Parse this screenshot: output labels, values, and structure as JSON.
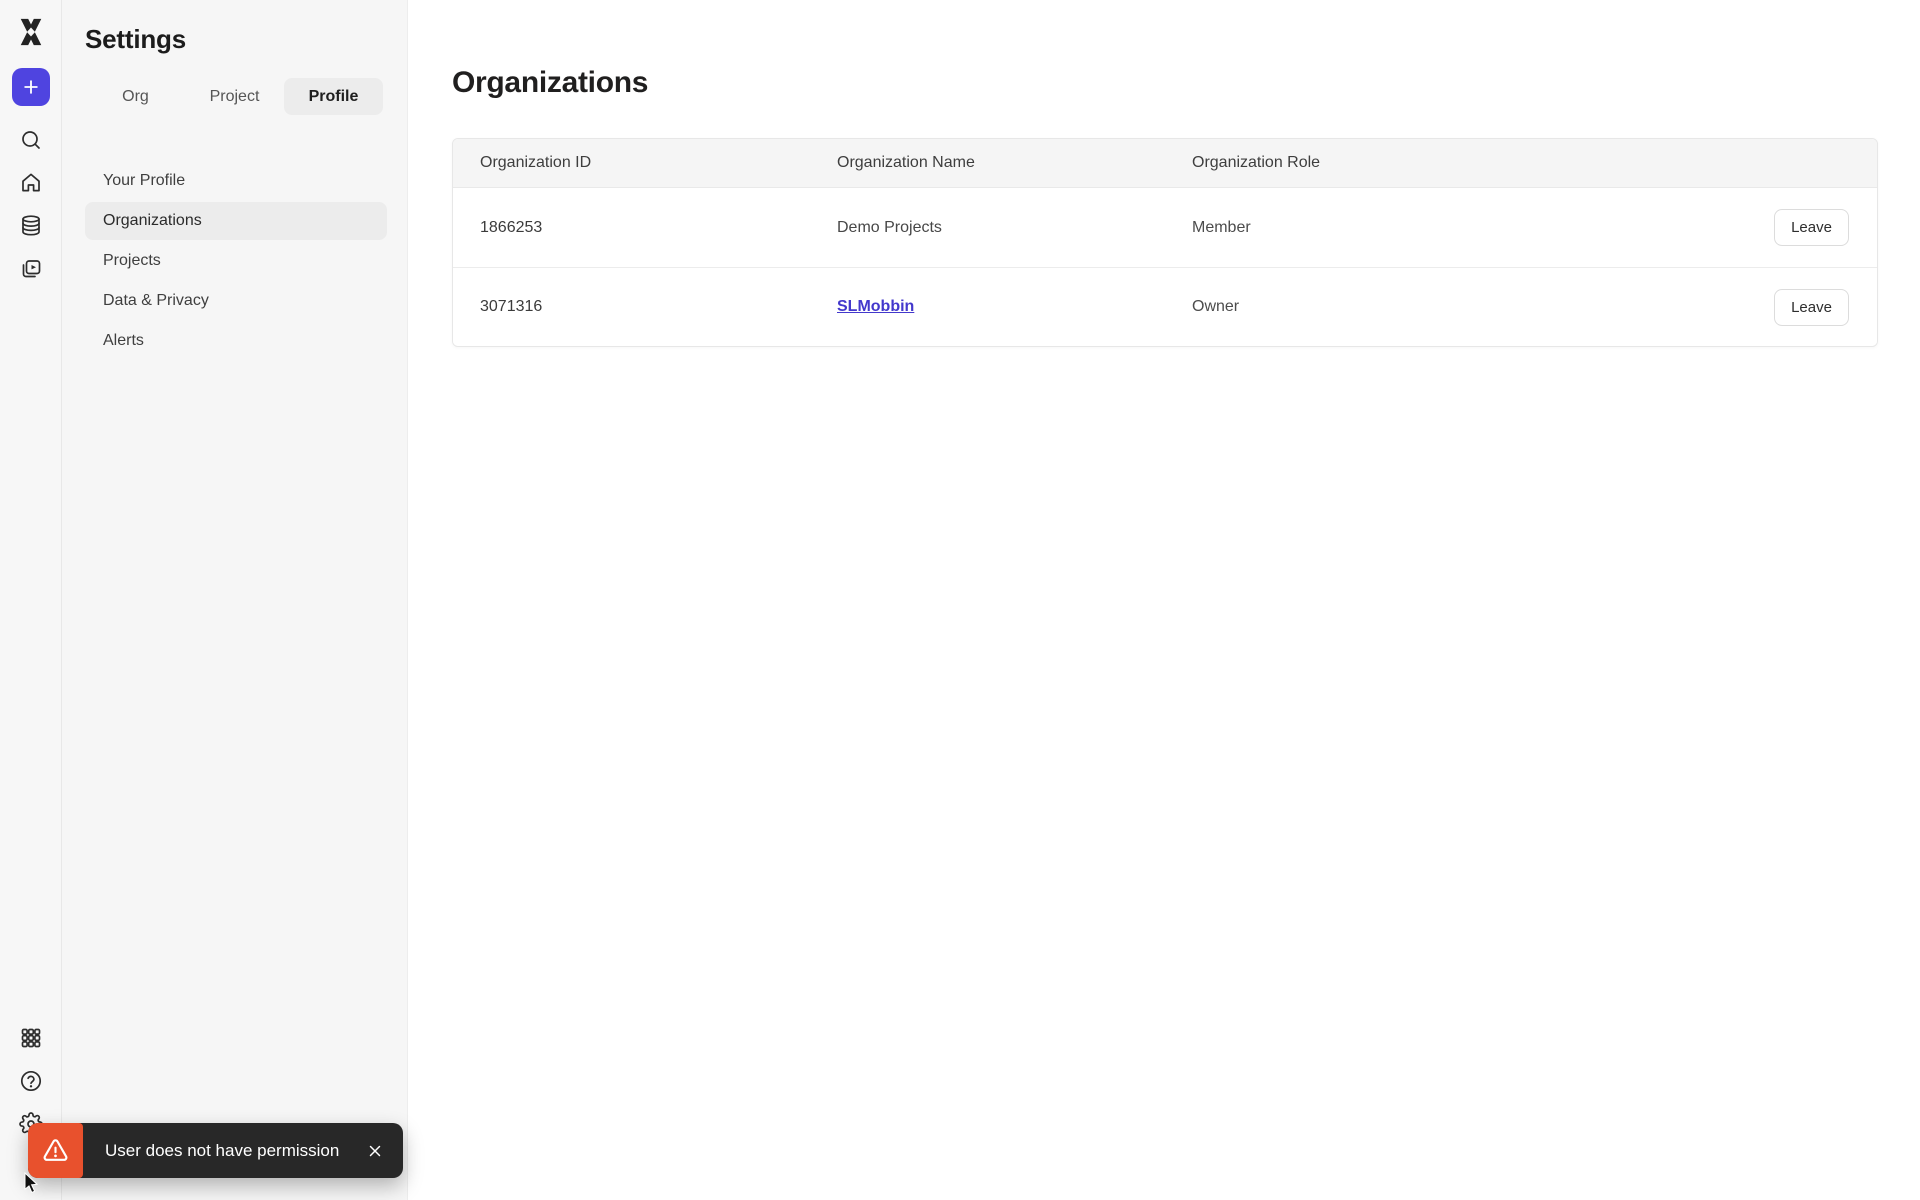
{
  "rail": {
    "icons": [
      "mixpanel-logo",
      "plus",
      "search",
      "home",
      "database",
      "video-boards",
      "apps-grid",
      "help",
      "settings-gear"
    ]
  },
  "sidebar": {
    "title": "Settings",
    "tabs": [
      {
        "label": "Org",
        "active": false
      },
      {
        "label": "Project",
        "active": false
      },
      {
        "label": "Profile",
        "active": true
      }
    ],
    "items": [
      {
        "label": "Your Profile",
        "active": false
      },
      {
        "label": "Organizations",
        "active": true
      },
      {
        "label": "Projects",
        "active": false
      },
      {
        "label": "Data & Privacy",
        "active": false
      },
      {
        "label": "Alerts",
        "active": false
      }
    ]
  },
  "main": {
    "title": "Organizations",
    "table": {
      "columns": [
        "Organization ID",
        "Organization Name",
        "Organization Role"
      ],
      "rows": [
        {
          "id": "1866253",
          "name": "Demo Projects",
          "name_is_link": false,
          "role": "Member",
          "action": "Leave"
        },
        {
          "id": "3071316",
          "name": "SLMobbin",
          "name_is_link": true,
          "role": "Owner",
          "action": "Leave"
        }
      ]
    }
  },
  "toast": {
    "message": "User does not have permission",
    "icon": "warning-triangle-icon"
  },
  "colors": {
    "accent_purple": "#4f44e0",
    "link_indigo": "#4338cc",
    "toast_background": "#282828",
    "warning_orange": "#e8512d",
    "sidebar_background": "#f6f6f6",
    "table_header_background": "#f5f5f5"
  }
}
